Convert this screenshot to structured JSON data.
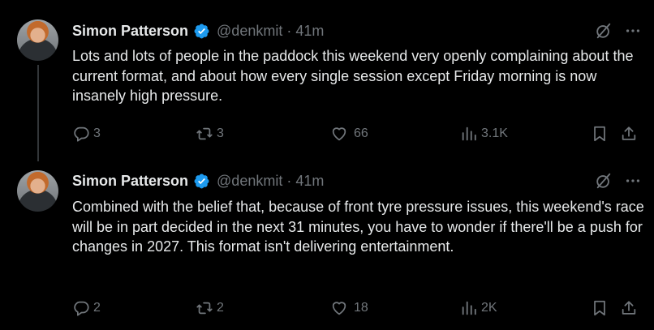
{
  "tweets": [
    {
      "author": "Simon Patterson",
      "handle": "@denkmit",
      "separator": "·",
      "time": "41m",
      "text": "Lots and lots of people in the paddock this weekend very openly complaining about the current format, and about how every single session except Friday morning is now insanely high pressure.",
      "replies": "3",
      "reposts": "3",
      "likes": "66",
      "views": "3.1K"
    },
    {
      "author": "Simon Patterson",
      "handle": "@denkmit",
      "separator": "·",
      "time": "41m",
      "text": "Combined with the belief that, because of front tyre pressure issues, this weekend's race will be in part decided in the next 31 minutes, you have to wonder if there'll be a push for changes in 2027. This format isn't delivering entertainment.",
      "replies": "2",
      "reposts": "2",
      "likes": "18",
      "views": "2K"
    }
  ],
  "icons": {
    "verified": "verified-badge-icon",
    "grok": "grok-icon",
    "more": "more-icon",
    "reply": "reply-icon",
    "repost": "repost-icon",
    "like": "like-icon",
    "views": "views-icon",
    "bookmark": "bookmark-icon",
    "share": "share-icon"
  },
  "colors": {
    "background": "#000000",
    "text": "#e7e9ea",
    "muted": "#71767b",
    "verified": "#1d9bf0"
  }
}
